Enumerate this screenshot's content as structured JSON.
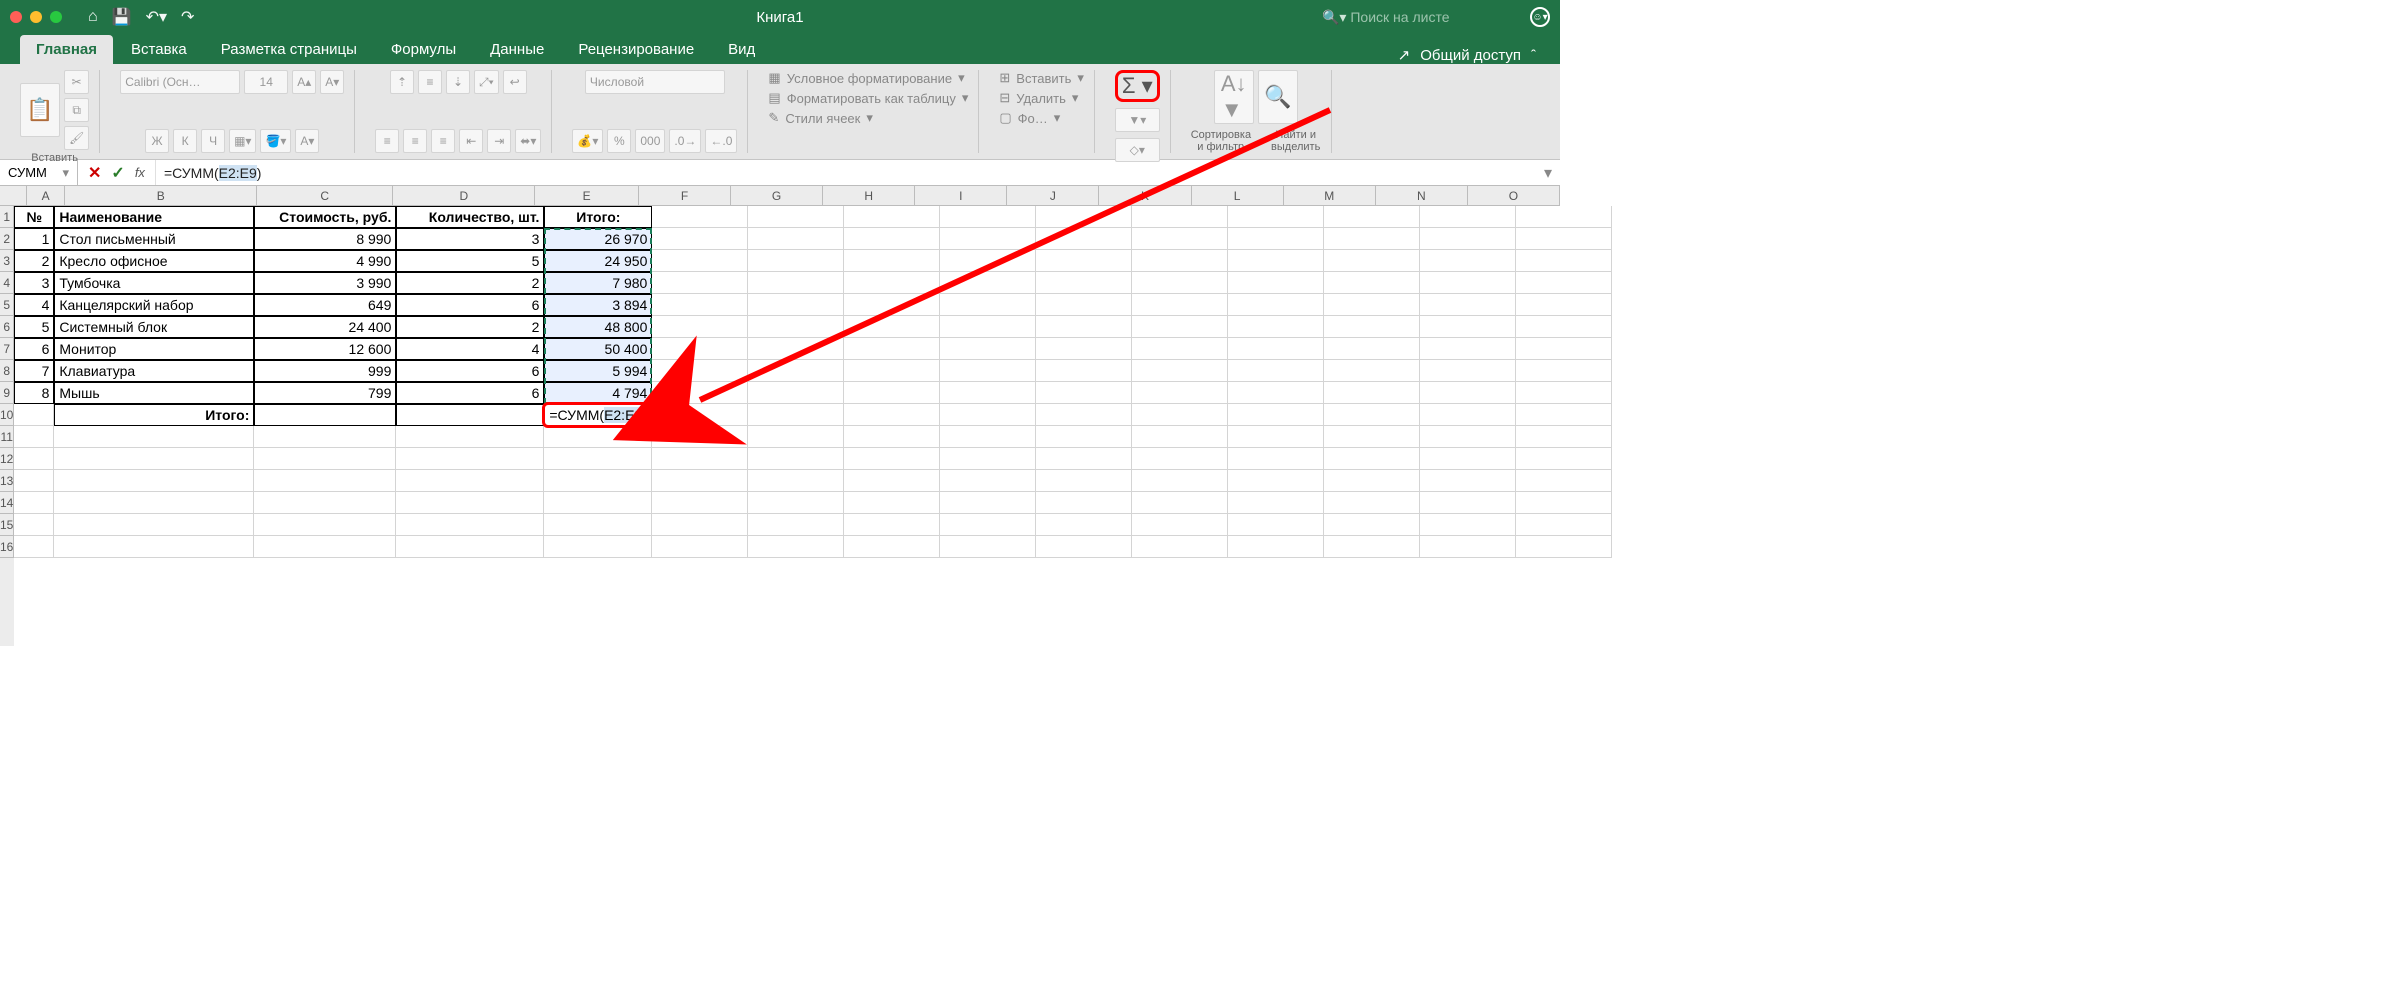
{
  "title": "Книга1",
  "search_placeholder": "Поиск на листе",
  "share_label": "Общий доступ",
  "tabs": [
    "Главная",
    "Вставка",
    "Разметка страницы",
    "Формулы",
    "Данные",
    "Рецензирование",
    "Вид"
  ],
  "active_tab": "Главная",
  "ribbon": {
    "paste": "Вставить",
    "font_name": "Calibri (Осн…",
    "font_size": "14",
    "number_format": "Числовой",
    "cond_fmt": "Условное форматирование",
    "as_table": "Форматировать как таблицу",
    "cell_styles": "Стили ячеек",
    "insert": "Вставить",
    "delete": "Удалить",
    "format": "Фо…",
    "sort_filter": "Сортировка и фильтр",
    "find_select": "Найти и выделить"
  },
  "formula_bar": {
    "name_box": "СУММ",
    "formula_pre": "=СУММ(",
    "formula_ref": "E2:E9",
    "formula_post": ")"
  },
  "columns": [
    "A",
    "B",
    "C",
    "D",
    "E",
    "F",
    "G",
    "H",
    "I",
    "J",
    "K",
    "L",
    "M",
    "N",
    "O"
  ],
  "headers": {
    "A": "№",
    "B": "Наименование",
    "C": "Стоимость, руб.",
    "D": "Количество, шт.",
    "E": "Итого:"
  },
  "rows": [
    {
      "n": "1",
      "name": "Стол письменный",
      "price": "8 990",
      "qty": "3",
      "total": "26 970"
    },
    {
      "n": "2",
      "name": "Кресло офисное",
      "price": "4 990",
      "qty": "5",
      "total": "24 950"
    },
    {
      "n": "3",
      "name": "Тумбочка",
      "price": "3 990",
      "qty": "2",
      "total": "7 980"
    },
    {
      "n": "4",
      "name": "Канцелярский набор",
      "price": "649",
      "qty": "6",
      "total": "3 894"
    },
    {
      "n": "5",
      "name": "Системный блок",
      "price": "24 400",
      "qty": "2",
      "total": "48 800"
    },
    {
      "n": "6",
      "name": "Монитор",
      "price": "12 600",
      "qty": "4",
      "total": "50 400"
    },
    {
      "n": "7",
      "name": "Клавиатура",
      "price": "999",
      "qty": "6",
      "total": "5 994"
    },
    {
      "n": "8",
      "name": "Мышь",
      "price": "799",
      "qty": "6",
      "total": "4 794"
    }
  ],
  "footer_label": "Итого:",
  "edit_formula_pre": "=СУММ(",
  "edit_formula_ref": "E2:E9",
  "edit_formula_post": ")",
  "row_numbers": [
    "1",
    "2",
    "3",
    "4",
    "5",
    "6",
    "7",
    "8",
    "9",
    "10",
    "11",
    "12",
    "13",
    "14",
    "15",
    "16"
  ],
  "font_btns": {
    "bold": "Ж",
    "italic": "К",
    "underline": "Ч"
  }
}
